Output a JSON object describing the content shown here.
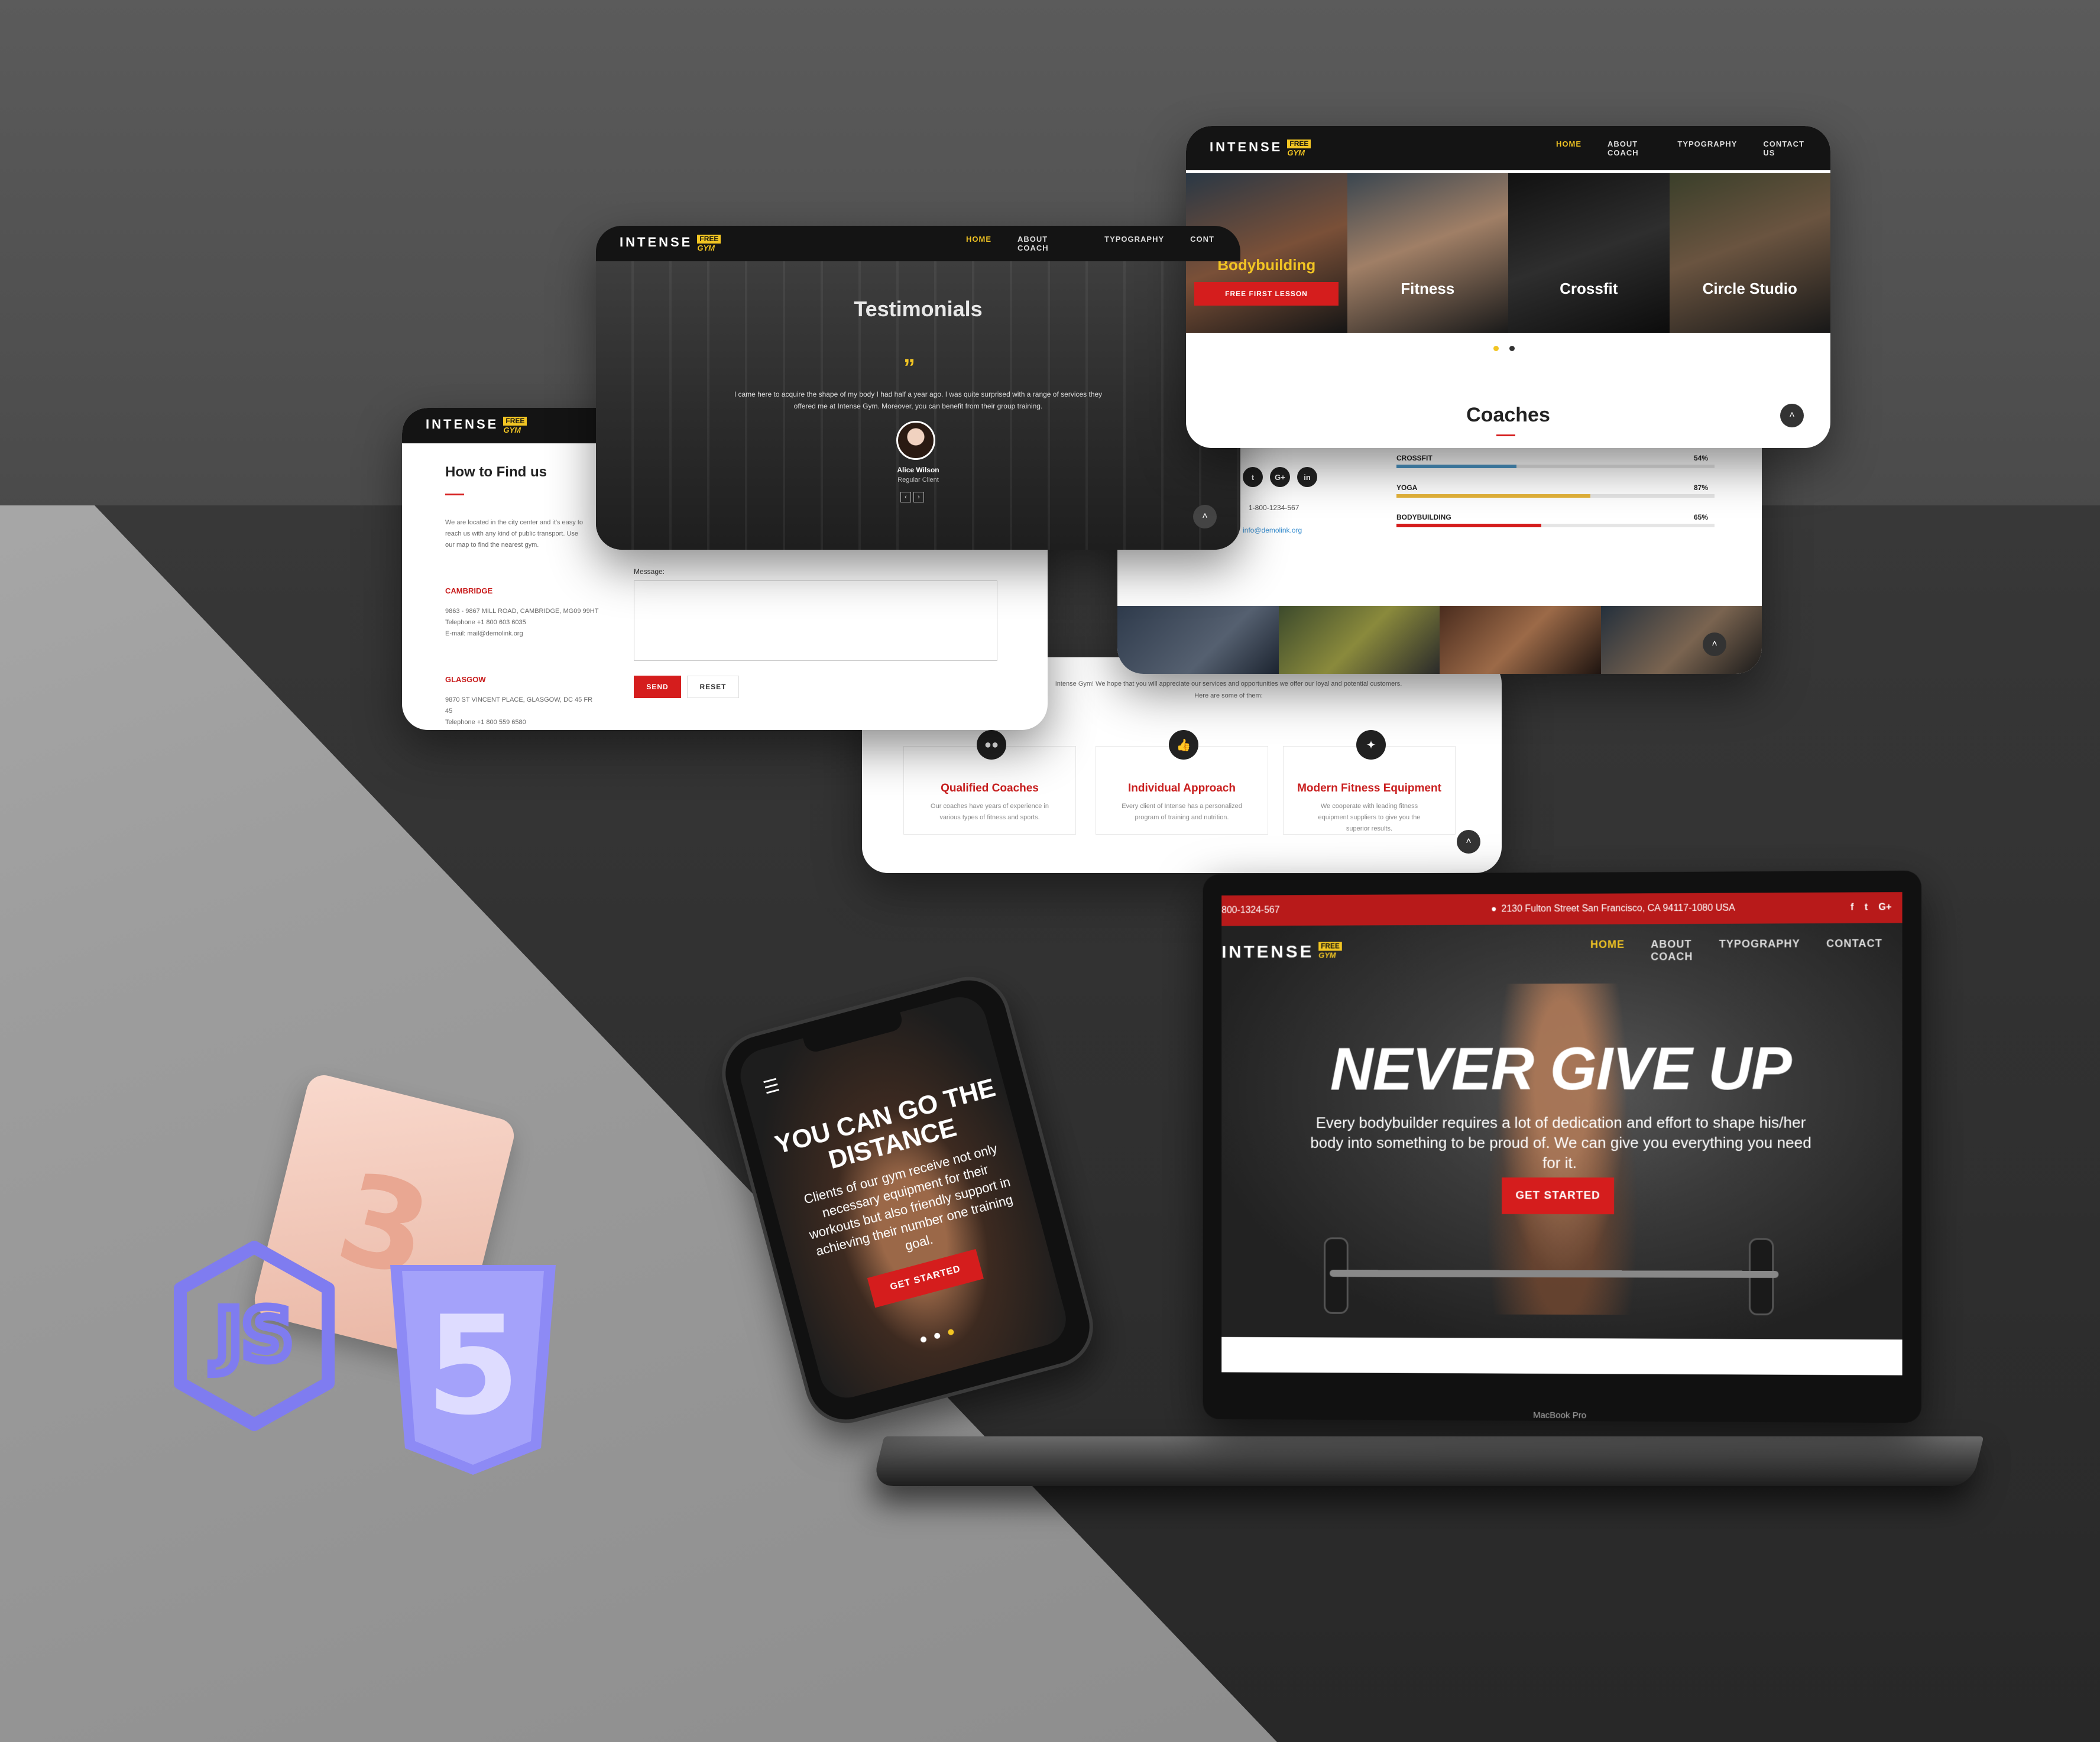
{
  "brand": {
    "name": "INTENSE",
    "free": "FREE",
    "gym": "GYM"
  },
  "nav": {
    "home": "HOME",
    "about": "ABOUT COACH",
    "typography": "TYPOGRAPHY",
    "contact": "CONTACT US",
    "contact_cut": "CONT",
    "contact_cut2": "CONTACT"
  },
  "find_us": {
    "title": "How to Find us",
    "intro": "We are located in the city center and it's easy to reach us with any kind of public transport. Use our map to find the nearest gym.",
    "locations": [
      {
        "city": "CAMBRIDGE",
        "address": "9863 - 9867 MILL ROAD, CAMBRIDGE, MG09 99HT",
        "phone": "Telephone +1 800 603 6035",
        "email": "E-mail: mail@demolink.org"
      },
      {
        "city": "GLASGOW",
        "address": "9870 ST VINCENT PLACE, GLASGOW, DC 45 FR 45",
        "phone": "Telephone +1 800 559 6580"
      }
    ],
    "message_label": "Message:",
    "send": "SEND",
    "reset": "RESET"
  },
  "testimonials": {
    "title": "Testimonials",
    "quote": "”",
    "text": "I came here to acquire the shape of my body I had half a year ago. I was quite surprised with a range of services they offered me at Intense Gym. Moreover, you can benefit from their group training.",
    "name": "Alice Wilson",
    "role": "Regular Client"
  },
  "features": {
    "intro": "Intense Gym! We hope that you will appreciate our services and opportunities we offer our loyal and potential customers. Here are some of them:",
    "items": [
      {
        "title": "Qualified Coaches",
        "text": "Our coaches have years of experience in various types of fitness and sports.",
        "icon": "group-icon"
      },
      {
        "title": "Individual Approach",
        "text": "Every client of Intense has a personalized program of training and nutrition.",
        "icon": "thumbs-up-icon"
      },
      {
        "title": "Modern Fitness Equipment",
        "text": "We cooperate with leading fitness equipment suppliers to give you the superior results.",
        "icon": "dumbbell-icon"
      }
    ]
  },
  "contacts_small": {
    "phone": "1-800-1234-567",
    "email": "info@demolink.org",
    "social": [
      "t",
      "G+",
      "in"
    ]
  },
  "skills": [
    {
      "label": "CROSSFIT",
      "value": 54,
      "pct": "54%",
      "color": "#4b95c4"
    },
    {
      "label": "YOGA",
      "value": 87,
      "pct": "87%",
      "color": "#e5b43a"
    },
    {
      "label": "BODYBUILDING",
      "value": 65,
      "pct": "65%",
      "color": "#d51d1d"
    }
  ],
  "classes": {
    "items": [
      "Bodybuilding",
      "Fitness",
      "Crossfit",
      "Circle Studio"
    ],
    "cta": "FREE FIRST LESSON",
    "section_title": "Coaches"
  },
  "laptop": {
    "phone": "800-1324-567",
    "address": "2130 Fulton Street San Francisco, CA 94117-1080 USA",
    "headline": "NEVER GIVE UP",
    "sub": "Every bodybuilder requires a lot of dedication and effort to shape his/her body into something to be proud of. We can give you everything you need for it.",
    "cta": "GET STARTED",
    "device_label": "MacBook Pro"
  },
  "phone": {
    "headline": "YOU CAN GO THE DISTANCE",
    "text": "Clients of our gym receive not only necessary equipment for their workouts but also friendly support in achieving their number one training goal.",
    "cta": "GET STARTED"
  },
  "badges": {
    "js": "JS",
    "css": "3",
    "html": "5"
  },
  "colors": {
    "accent": "#d51d1d",
    "yellow": "#f2c523",
    "dark": "#141414"
  }
}
